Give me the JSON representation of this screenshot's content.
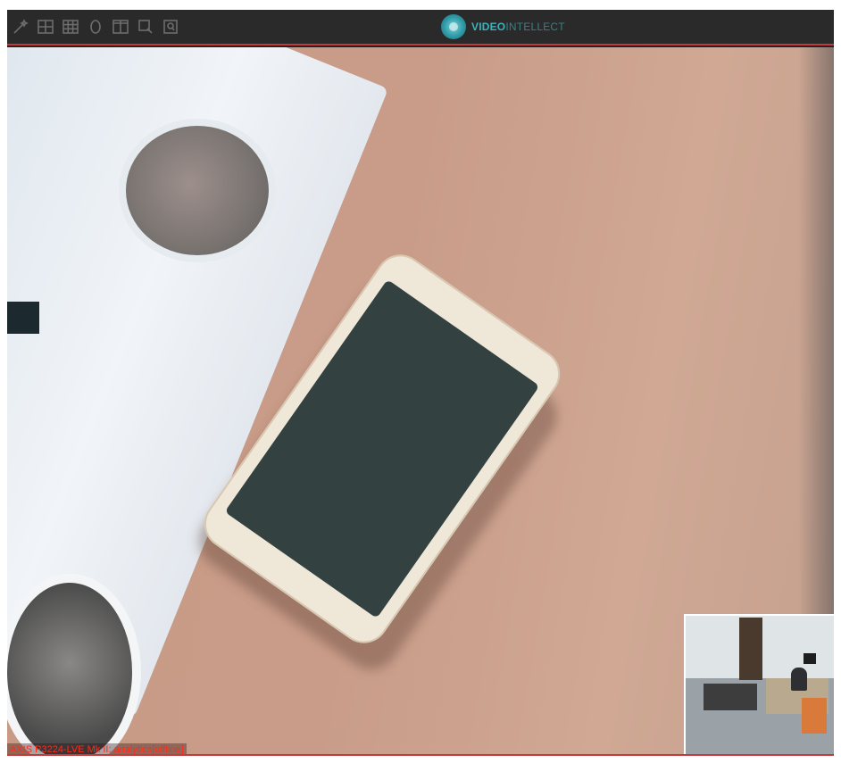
{
  "toolbar": {
    "icons": [
      "wand-icon",
      "layout-4-icon",
      "layout-9-icon",
      "circle-icon",
      "layout-columns-icon",
      "zoom-icon",
      "search-icon"
    ],
    "accent_color": "#c23a3a"
  },
  "brand": {
    "logo_icon": "videointellect-logo-icon",
    "name_bold": "VIDEO",
    "name_light": "INTELLECT"
  },
  "camera": {
    "label": "AXIS P3224-LVE Mk II: analytics[offline]",
    "label_color": "#ff2a1a"
  }
}
